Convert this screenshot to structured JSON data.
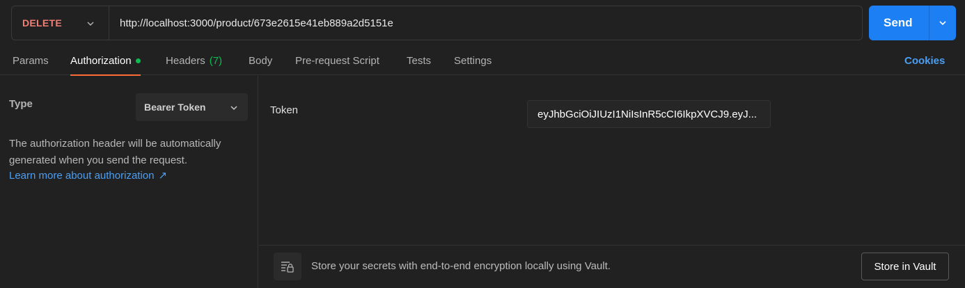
{
  "request": {
    "method": "DELETE",
    "url": "http://localhost:3000/product/673e2615e41eb889a2d5151e",
    "send_label": "Send"
  },
  "tabs": [
    {
      "label": "Params"
    },
    {
      "label": "Authorization",
      "active": true
    },
    {
      "label": "Headers",
      "count": "(7)"
    },
    {
      "label": "Body"
    },
    {
      "label": "Pre-request Script"
    },
    {
      "label": "Tests"
    },
    {
      "label": "Settings"
    }
  ],
  "cookies_label": "Cookies",
  "auth": {
    "type_label": "Type",
    "type_value": "Bearer Token",
    "description": "The authorization header will be automatically generated when you send the request.",
    "learn_more": "Learn more about authorization",
    "learn_more_arrow": "↗",
    "token_label": "Token",
    "token_value": "eyJhbGciOiJIUzI1NiIsInR5cCI6IkpXVCJ9.eyJ..."
  },
  "vault": {
    "message": "Store your secrets with end-to-end encryption locally using Vault.",
    "button_label": "Store in Vault"
  },
  "colors": {
    "method": "#f07f75",
    "send": "#1c7ff3",
    "active_tab_underline": "#ff6c37",
    "indicator_green": "#0cbb52",
    "link": "#4a9ff5"
  }
}
